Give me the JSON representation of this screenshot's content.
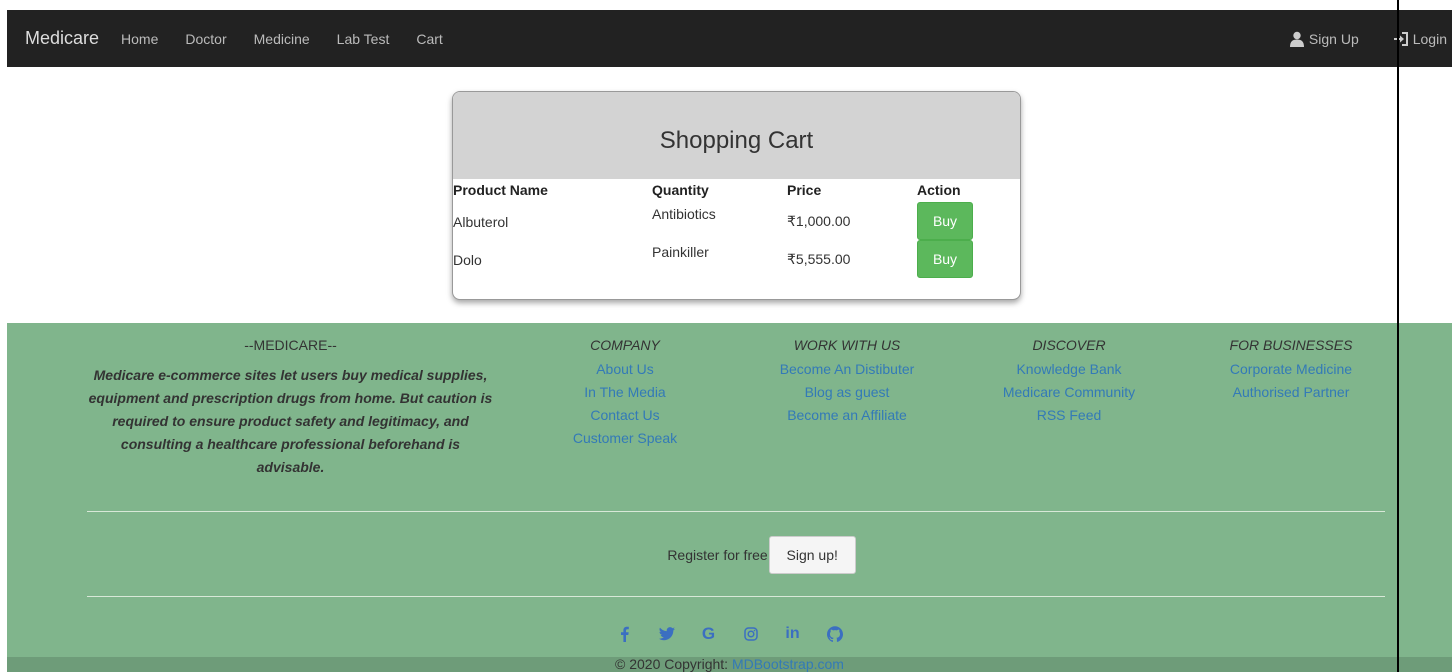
{
  "nav": {
    "brand": "Medicare",
    "links": [
      "Home",
      "Doctor",
      "Medicine",
      "Lab Test",
      "Cart"
    ],
    "signup": "Sign Up",
    "login": "Login"
  },
  "cart": {
    "title": "Shopping Cart",
    "columns": [
      "Product Name",
      "Quantity",
      "Price",
      "Action"
    ],
    "rows": [
      {
        "name": "Albuterol",
        "quantity": "Antibiotics",
        "price": "₹1,000.00",
        "action": "Buy"
      },
      {
        "name": "Dolo",
        "quantity": "Painkiller",
        "price": "₹5,555.00",
        "action": "Buy"
      }
    ]
  },
  "footer": {
    "about_head": "--MEDICARE--",
    "about_text": "Medicare e-commerce sites let users buy medical supplies, equipment and prescription drugs from home. But caution is required to ensure product safety and legitimacy, and consulting a healthcare professional beforehand is advisable.",
    "columns": [
      {
        "head": "COMPANY",
        "links": [
          "About Us",
          "In The Media",
          "Contact Us",
          "Customer Speak"
        ]
      },
      {
        "head": "WORK WITH US",
        "links": [
          "Become An Distibuter",
          "Blog as guest",
          "Become an Affiliate"
        ]
      },
      {
        "head": "DISCOVER",
        "links": [
          "Knowledge Bank",
          "Medicare Community",
          "RSS Feed"
        ]
      },
      {
        "head": "FOR BUSINESSES",
        "links": [
          "Corporate Medicine",
          "Authorised Partner"
        ]
      }
    ],
    "register_text": "Register for free",
    "signup_button": "Sign up!",
    "socials": [
      "facebook-icon",
      "twitter-icon",
      "google-icon",
      "instagram-icon",
      "linkedin-icon",
      "github-icon"
    ],
    "copyright_prefix": "© 2020 Copyright:",
    "copyright_link": "MDBootstrap.com"
  }
}
